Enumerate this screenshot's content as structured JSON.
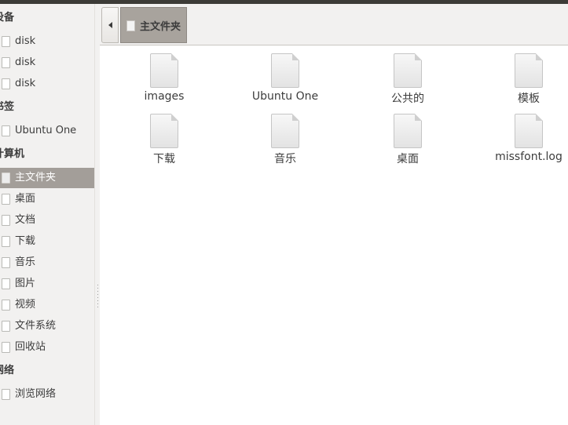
{
  "sidebar": {
    "devices": {
      "header": "设备",
      "items": [
        {
          "label": "disk",
          "icon": "drive-icon"
        },
        {
          "label": "disk",
          "icon": "drive-icon"
        },
        {
          "label": "disk",
          "icon": "drive-icon"
        }
      ]
    },
    "bookmarks": {
      "header": "书签",
      "items": [
        {
          "label": "Ubuntu One",
          "icon": "folder-icon"
        }
      ]
    },
    "computer": {
      "header": "计算机",
      "items": [
        {
          "label": "主文件夹",
          "icon": "home-folder-icon",
          "selected": true
        },
        {
          "label": "桌面",
          "icon": "desktop-icon"
        },
        {
          "label": "文档",
          "icon": "documents-icon"
        },
        {
          "label": "下载",
          "icon": "downloads-icon"
        },
        {
          "label": "音乐",
          "icon": "music-icon"
        },
        {
          "label": "图片",
          "icon": "pictures-icon"
        },
        {
          "label": "视频",
          "icon": "videos-icon"
        },
        {
          "label": "文件系统",
          "icon": "filesystem-icon"
        },
        {
          "label": "回收站",
          "icon": "trash-icon"
        }
      ]
    },
    "network": {
      "header": "网络",
      "items": [
        {
          "label": "浏览网络",
          "icon": "network-icon"
        }
      ]
    }
  },
  "toolbar": {
    "back_icon": "chevron-left-icon",
    "breadcrumb": {
      "label": "主文件夹",
      "icon": "home-folder-icon"
    }
  },
  "files": [
    {
      "name": "images",
      "icon": "folder-icon"
    },
    {
      "name": "Ubuntu One",
      "icon": "folder-icon"
    },
    {
      "name": "公共的",
      "icon": "folder-icon"
    },
    {
      "name": "模板",
      "icon": "folder-icon"
    },
    {
      "name": "下载",
      "icon": "folder-icon"
    },
    {
      "name": "音乐",
      "icon": "folder-icon"
    },
    {
      "name": "桌面",
      "icon": "folder-icon"
    },
    {
      "name": "missfont.log",
      "icon": "file-icon"
    }
  ],
  "colors": {
    "selection": "#a39e99",
    "sidebar_bg": "#f2f1f0",
    "titlebar": "#3c3b37"
  }
}
